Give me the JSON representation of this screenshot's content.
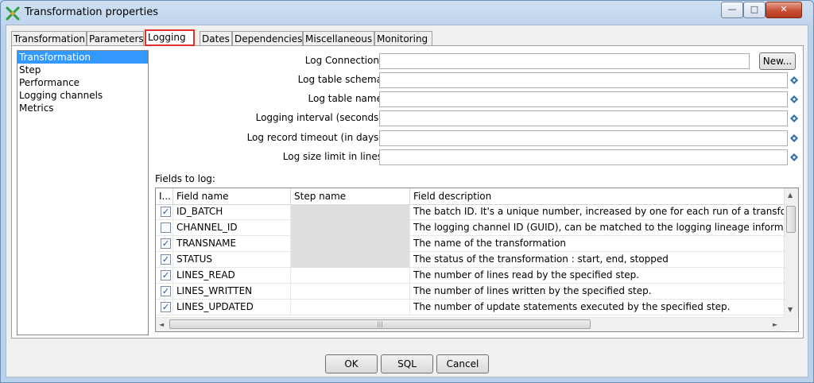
{
  "window": {
    "title": "Transformation properties",
    "min_label": "—",
    "max_label": "□",
    "close_label": "✕"
  },
  "tabs": [
    {
      "label": "Transformation"
    },
    {
      "label": "Parameters"
    },
    {
      "label": "Logging"
    },
    {
      "label": "Dates"
    },
    {
      "label": "Dependencies"
    },
    {
      "label": "Miscellaneous"
    },
    {
      "label": "Monitoring"
    }
  ],
  "categories": [
    {
      "label": "Transformation",
      "selected": true
    },
    {
      "label": "Step"
    },
    {
      "label": "Performance"
    },
    {
      "label": "Logging channels"
    },
    {
      "label": "Metrics"
    }
  ],
  "form": {
    "log_connection_label": "Log Connection:",
    "log_connection_value": "",
    "new_button": "New...",
    "schema_label": "Log table schema",
    "schema_value": "",
    "table_label": "Log table name",
    "table_value": "",
    "interval_label": "Logging interval (seconds)",
    "interval_value": "",
    "timeout_label": "Log record timeout (in days)",
    "timeout_value": "",
    "size_label": "Log size limit in lines",
    "size_value": ""
  },
  "fields_to_log": {
    "label": "Fields to log:",
    "columns": [
      "I...",
      "Field name",
      "Step name",
      "Field description"
    ],
    "rows": [
      {
        "checked": true,
        "field": "ID_BATCH",
        "step": "",
        "step_grey": true,
        "desc": "The batch ID. It's a unique number, increased by one for each run of a transform"
      },
      {
        "checked": false,
        "field": "CHANNEL_ID",
        "step": "",
        "step_grey": true,
        "desc": "The logging channel ID (GUID), can be matched to the logging lineage informat"
      },
      {
        "checked": true,
        "field": "TRANSNAME",
        "step": "",
        "step_grey": true,
        "desc": "The name of the transformation"
      },
      {
        "checked": true,
        "field": "STATUS",
        "step": "",
        "step_grey": true,
        "desc": "The status of the transformation : start, end, stopped"
      },
      {
        "checked": true,
        "field": "LINES_READ",
        "step": "",
        "step_grey": false,
        "desc": "The number of lines read by the specified step."
      },
      {
        "checked": true,
        "field": "LINES_WRITTEN",
        "step": "",
        "step_grey": false,
        "desc": "The number of lines written by the specified step."
      },
      {
        "checked": true,
        "field": "LINES_UPDATED",
        "step": "",
        "step_grey": false,
        "desc": "The number of update statements executed by the specified step."
      }
    ]
  },
  "buttons": {
    "ok": "OK",
    "sql": "SQL",
    "cancel": "Cancel"
  },
  "colors": {
    "active_tab_outline": "#e0322d",
    "selection": "#3399ff"
  }
}
